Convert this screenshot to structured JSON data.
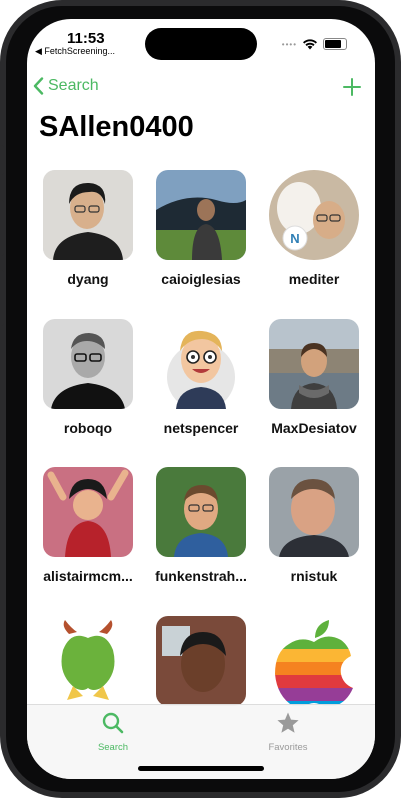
{
  "status_bar": {
    "time": "11:53",
    "back_app": "◀ FetchScreening...",
    "icons": [
      "signal-dots-icon",
      "wifi-icon",
      "battery-icon"
    ]
  },
  "nav": {
    "back_label": "Search",
    "add_icon": "plus-icon"
  },
  "page": {
    "title": "SAllen0400"
  },
  "colors": {
    "accent": "#4cb963",
    "tab_inactive": "#9a9a9a"
  },
  "users": [
    {
      "username": "dyang",
      "avatar_style": "photo"
    },
    {
      "username": "caioiglesias",
      "avatar_style": "photo"
    },
    {
      "username": "mediter",
      "avatar_style": "round-photo"
    },
    {
      "username": "roboqo",
      "avatar_style": "photo"
    },
    {
      "username": "netspencer",
      "avatar_style": "cartoon"
    },
    {
      "username": "MaxDesiatov",
      "avatar_style": "photo"
    },
    {
      "username": "alistairmcm...",
      "avatar_style": "cartoon"
    },
    {
      "username": "funkenstrah...",
      "avatar_style": "photo"
    },
    {
      "username": "rnistuk",
      "avatar_style": "photo"
    },
    {
      "username": "",
      "avatar_style": "logo"
    },
    {
      "username": "",
      "avatar_style": "photo"
    },
    {
      "username": "",
      "avatar_style": "logo"
    }
  ],
  "tab_bar": {
    "tabs": [
      {
        "label": "Search",
        "icon": "magnifier-icon",
        "selected": true
      },
      {
        "label": "Favorites",
        "icon": "star-icon",
        "selected": false
      }
    ]
  }
}
